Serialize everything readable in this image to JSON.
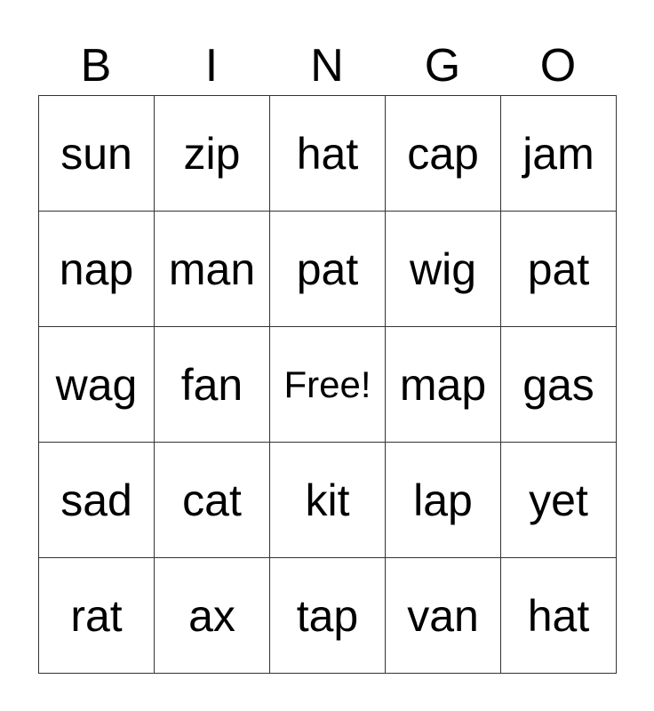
{
  "header": [
    "B",
    "I",
    "N",
    "G",
    "O"
  ],
  "rows": [
    [
      "sun",
      "zip",
      "hat",
      "cap",
      "jam"
    ],
    [
      "nap",
      "man",
      "pat",
      "wig",
      "pat"
    ],
    [
      "wag",
      "fan",
      "Free!",
      "map",
      "gas"
    ],
    [
      "sad",
      "cat",
      "kit",
      "lap",
      "yet"
    ],
    [
      "rat",
      "ax",
      "tap",
      "van",
      "hat"
    ]
  ]
}
